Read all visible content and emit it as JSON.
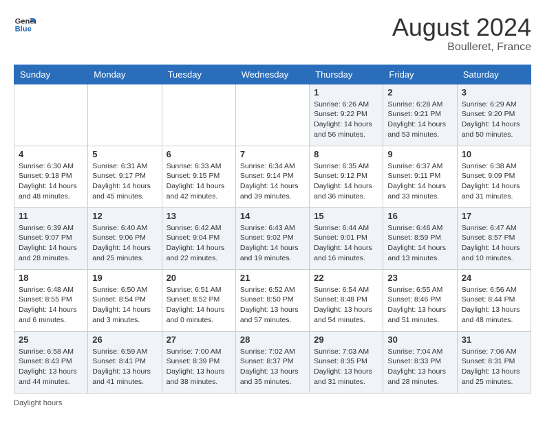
{
  "header": {
    "logo_line1": "General",
    "logo_line2": "Blue",
    "month_year": "August 2024",
    "location": "Boulleret, France"
  },
  "footer": {
    "daylight_label": "Daylight hours"
  },
  "columns": [
    "Sunday",
    "Monday",
    "Tuesday",
    "Wednesday",
    "Thursday",
    "Friday",
    "Saturday"
  ],
  "weeks": [
    {
      "days": [
        {
          "number": "",
          "info": ""
        },
        {
          "number": "",
          "info": ""
        },
        {
          "number": "",
          "info": ""
        },
        {
          "number": "",
          "info": ""
        },
        {
          "number": "1",
          "info": "Sunrise: 6:26 AM\nSunset: 9:22 PM\nDaylight: 14 hours\nand 56 minutes."
        },
        {
          "number": "2",
          "info": "Sunrise: 6:28 AM\nSunset: 9:21 PM\nDaylight: 14 hours\nand 53 minutes."
        },
        {
          "number": "3",
          "info": "Sunrise: 6:29 AM\nSunset: 9:20 PM\nDaylight: 14 hours\nand 50 minutes."
        }
      ]
    },
    {
      "days": [
        {
          "number": "4",
          "info": "Sunrise: 6:30 AM\nSunset: 9:18 PM\nDaylight: 14 hours\nand 48 minutes."
        },
        {
          "number": "5",
          "info": "Sunrise: 6:31 AM\nSunset: 9:17 PM\nDaylight: 14 hours\nand 45 minutes."
        },
        {
          "number": "6",
          "info": "Sunrise: 6:33 AM\nSunset: 9:15 PM\nDaylight: 14 hours\nand 42 minutes."
        },
        {
          "number": "7",
          "info": "Sunrise: 6:34 AM\nSunset: 9:14 PM\nDaylight: 14 hours\nand 39 minutes."
        },
        {
          "number": "8",
          "info": "Sunrise: 6:35 AM\nSunset: 9:12 PM\nDaylight: 14 hours\nand 36 minutes."
        },
        {
          "number": "9",
          "info": "Sunrise: 6:37 AM\nSunset: 9:11 PM\nDaylight: 14 hours\nand 33 minutes."
        },
        {
          "number": "10",
          "info": "Sunrise: 6:38 AM\nSunset: 9:09 PM\nDaylight: 14 hours\nand 31 minutes."
        }
      ]
    },
    {
      "days": [
        {
          "number": "11",
          "info": "Sunrise: 6:39 AM\nSunset: 9:07 PM\nDaylight: 14 hours\nand 28 minutes."
        },
        {
          "number": "12",
          "info": "Sunrise: 6:40 AM\nSunset: 9:06 PM\nDaylight: 14 hours\nand 25 minutes."
        },
        {
          "number": "13",
          "info": "Sunrise: 6:42 AM\nSunset: 9:04 PM\nDaylight: 14 hours\nand 22 minutes."
        },
        {
          "number": "14",
          "info": "Sunrise: 6:43 AM\nSunset: 9:02 PM\nDaylight: 14 hours\nand 19 minutes."
        },
        {
          "number": "15",
          "info": "Sunrise: 6:44 AM\nSunset: 9:01 PM\nDaylight: 14 hours\nand 16 minutes."
        },
        {
          "number": "16",
          "info": "Sunrise: 6:46 AM\nSunset: 8:59 PM\nDaylight: 14 hours\nand 13 minutes."
        },
        {
          "number": "17",
          "info": "Sunrise: 6:47 AM\nSunset: 8:57 PM\nDaylight: 14 hours\nand 10 minutes."
        }
      ]
    },
    {
      "days": [
        {
          "number": "18",
          "info": "Sunrise: 6:48 AM\nSunset: 8:55 PM\nDaylight: 14 hours\nand 6 minutes."
        },
        {
          "number": "19",
          "info": "Sunrise: 6:50 AM\nSunset: 8:54 PM\nDaylight: 14 hours\nand 3 minutes."
        },
        {
          "number": "20",
          "info": "Sunrise: 6:51 AM\nSunset: 8:52 PM\nDaylight: 14 hours\nand 0 minutes."
        },
        {
          "number": "21",
          "info": "Sunrise: 6:52 AM\nSunset: 8:50 PM\nDaylight: 13 hours\nand 57 minutes."
        },
        {
          "number": "22",
          "info": "Sunrise: 6:54 AM\nSunset: 8:48 PM\nDaylight: 13 hours\nand 54 minutes."
        },
        {
          "number": "23",
          "info": "Sunrise: 6:55 AM\nSunset: 8:46 PM\nDaylight: 13 hours\nand 51 minutes."
        },
        {
          "number": "24",
          "info": "Sunrise: 6:56 AM\nSunset: 8:44 PM\nDaylight: 13 hours\nand 48 minutes."
        }
      ]
    },
    {
      "days": [
        {
          "number": "25",
          "info": "Sunrise: 6:58 AM\nSunset: 8:43 PM\nDaylight: 13 hours\nand 44 minutes."
        },
        {
          "number": "26",
          "info": "Sunrise: 6:59 AM\nSunset: 8:41 PM\nDaylight: 13 hours\nand 41 minutes."
        },
        {
          "number": "27",
          "info": "Sunrise: 7:00 AM\nSunset: 8:39 PM\nDaylight: 13 hours\nand 38 minutes."
        },
        {
          "number": "28",
          "info": "Sunrise: 7:02 AM\nSunset: 8:37 PM\nDaylight: 13 hours\nand 35 minutes."
        },
        {
          "number": "29",
          "info": "Sunrise: 7:03 AM\nSunset: 8:35 PM\nDaylight: 13 hours\nand 31 minutes."
        },
        {
          "number": "30",
          "info": "Sunrise: 7:04 AM\nSunset: 8:33 PM\nDaylight: 13 hours\nand 28 minutes."
        },
        {
          "number": "31",
          "info": "Sunrise: 7:06 AM\nSunset: 8:31 PM\nDaylight: 13 hours\nand 25 minutes."
        }
      ]
    }
  ]
}
